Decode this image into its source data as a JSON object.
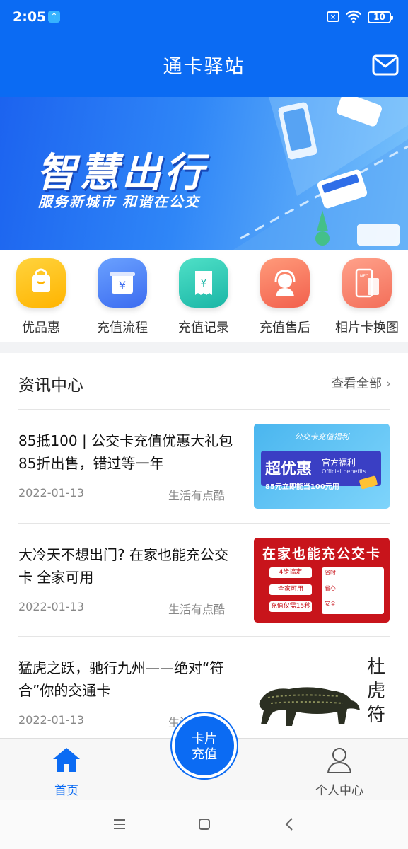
{
  "status_bar": {
    "time": "2:05",
    "battery": "10"
  },
  "header": {
    "title": "通卡驿站"
  },
  "banner": {
    "title": "智慧出行",
    "subtitle": "服务新城市 和谐在公交"
  },
  "quick_menu": [
    {
      "label": "优品惠",
      "icon": "shopping-bag-icon"
    },
    {
      "label": "充值流程",
      "icon": "recharge-yuan-icon"
    },
    {
      "label": "充值记录",
      "icon": "receipt-yuan-icon"
    },
    {
      "label": "充值售后",
      "icon": "customer-service-icon"
    },
    {
      "label": "相片卡换图",
      "icon": "photo-card-icon"
    }
  ],
  "news": {
    "heading": "资讯中心",
    "view_all": "查看全部",
    "items": [
      {
        "title": "85抵100 | 公交卡充值优惠大礼包85折出售，错过等一年",
        "date": "2022-01-13",
        "source": "生活有点酷"
      },
      {
        "title": "大冷天不想出门? 在家也能充公交卡 全家可用",
        "date": "2022-01-13",
        "source": "生活有点酷"
      },
      {
        "title": "猛虎之跃，驰行九州——绝对“符合”你的交通卡",
        "date": "2022-01-13",
        "source": "生活有点酷"
      }
    ],
    "thumb1": {
      "top": "公交卡充值福利",
      "big": "超优惠",
      "tag": "官方福利",
      "tag_en": "Official benefits",
      "bottom": "85元立即能当100元用"
    },
    "thumb2": {
      "title": "在家也能充公交卡",
      "b1": "4步搞定",
      "b2": "全家可用",
      "b3": "充值仅需15秒",
      "p1": "省时",
      "p2": "省心",
      "p3": "安全"
    },
    "thumb3": {
      "chars": "杜虎符"
    }
  },
  "tabbar": {
    "home": "首页",
    "recharge": "卡片充值",
    "user": "个人中心"
  },
  "colors": {
    "primary": "#0b6bf3"
  }
}
